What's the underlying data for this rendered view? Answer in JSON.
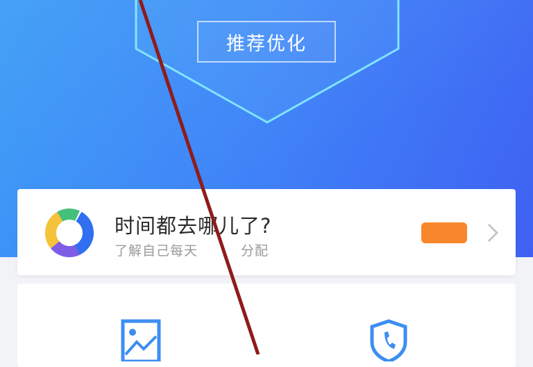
{
  "header": {
    "top_label": "",
    "optimize_button": "推荐优化"
  },
  "time_card": {
    "title": "时间都去哪儿了?",
    "subtitle": "了解自己每天",
    "subtitle_tail": "分配",
    "badge": "",
    "donut_colors": [
      "#2f6ff0",
      "#45c07a",
      "#f5c23b",
      "#7d5ce6"
    ]
  },
  "grid": {
    "items": [
      {
        "icon": "image-icon"
      },
      {
        "icon": "shield-phone-icon"
      }
    ]
  },
  "colors": {
    "header_start": "#3a9cf6",
    "header_end": "#3f61f2",
    "badge": "#f8872b",
    "icon_blue": "#3d8ef0",
    "strike_line": "#8e1c1c"
  }
}
